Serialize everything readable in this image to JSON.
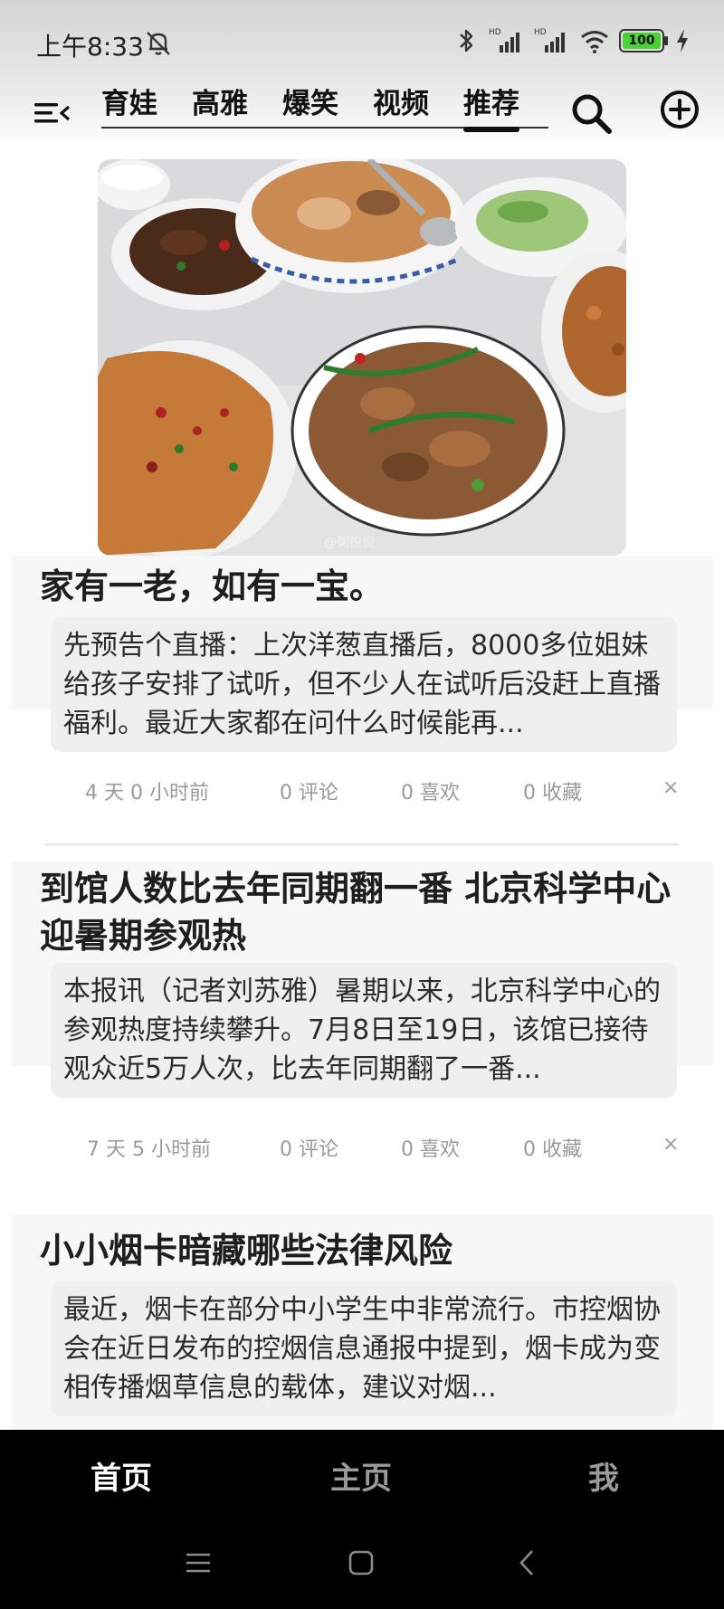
{
  "status_bar": {
    "time": "上午8:33",
    "battery": "100"
  },
  "top_nav": {
    "tabs": [
      {
        "label": "育娃",
        "active": false
      },
      {
        "label": "高雅",
        "active": false
      },
      {
        "label": "爆笑",
        "active": false
      },
      {
        "label": "视频",
        "active": false
      },
      {
        "label": "推荐",
        "active": true
      }
    ]
  },
  "hero_image": {
    "watermark": "@粥悦悦"
  },
  "articles": [
    {
      "title": "家有一老，如有一宝。",
      "summary": "先预告个直播：上次洋葱直播后，8000多位姐妹给孩子安排了试听，但不少人在试听后没赶上直播福利。最近大家都在问什么时候能再...",
      "time_ago": "4 天 0 小时前",
      "comments": "0 评论",
      "likes": "0 喜欢",
      "favorites": "0 收藏",
      "close": "×"
    },
    {
      "title": "到馆人数比去年同期翻一番 北京科学中心迎暑期参观热",
      "summary": "本报讯（记者刘苏雅）暑期以来，北京科学中心的参观热度持续攀升。7月8日至19日，该馆已接待观众近5万人次，比去年同期翻了一番...",
      "time_ago": "7 天 5 小时前",
      "comments": "0 评论",
      "likes": "0 喜欢",
      "favorites": "0 收藏",
      "close": "×"
    },
    {
      "title": "小小烟卡暗藏哪些法律风险",
      "summary": "最近，烟卡在部分中小学生中非常流行。市控烟协会在近日发布的控烟信息通报中提到，烟卡成为变相传播烟草信息的载体，建议对烟..."
    }
  ],
  "bottom_tabs": [
    {
      "label": "首页",
      "active": true
    },
    {
      "label": "主页",
      "active": false
    },
    {
      "label": "我",
      "active": false
    }
  ],
  "colors": {
    "active_tab": "#ffffff",
    "inactive_tab": "#9a9a9a",
    "battery_green": "#4cd137"
  }
}
